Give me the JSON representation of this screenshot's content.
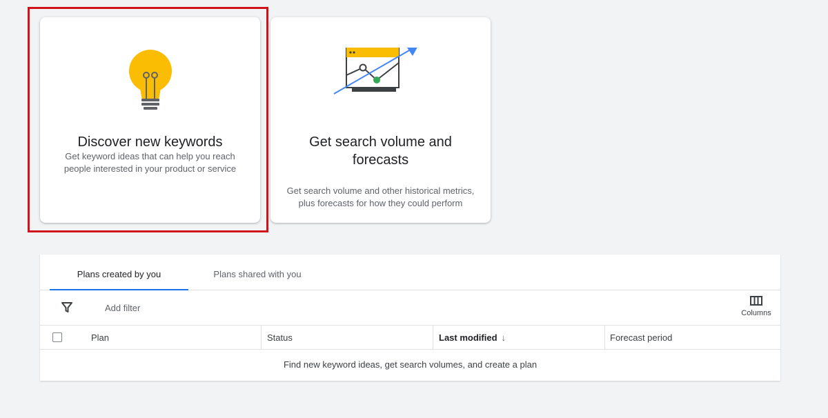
{
  "cards": [
    {
      "title": "Discover new keywords",
      "description_line1": "Get keyword ideas that can help you reach",
      "description_line2": "people interested in your product or service",
      "icon": "lightbulb-icon"
    },
    {
      "title_line1": "Get search volume and",
      "title_line2": "forecasts",
      "description_line1": "Get search volume and other historical metrics,",
      "description_line2": "plus forecasts for how they could perform",
      "icon": "chart-trend-icon"
    }
  ],
  "tabs": [
    {
      "label": "Plans created by you",
      "active": true
    },
    {
      "label": "Plans shared with you",
      "active": false
    }
  ],
  "toolbar": {
    "filter_icon": "filter-icon",
    "add_filter_label": "Add filter",
    "columns_label": "Columns",
    "columns_icon": "columns-icon"
  },
  "table": {
    "columns": [
      "Plan",
      "Status",
      "Last modified",
      "Forecast period"
    ],
    "sorted_column": "Last modified",
    "sort_direction": "descending",
    "empty_message": "Find new keyword ideas, get search volumes, and create a plan"
  },
  "colors": {
    "accent": "#1a73e8",
    "highlight": "#d0131b",
    "bulb": "#fbbc04",
    "chart_point": "#34a853"
  }
}
